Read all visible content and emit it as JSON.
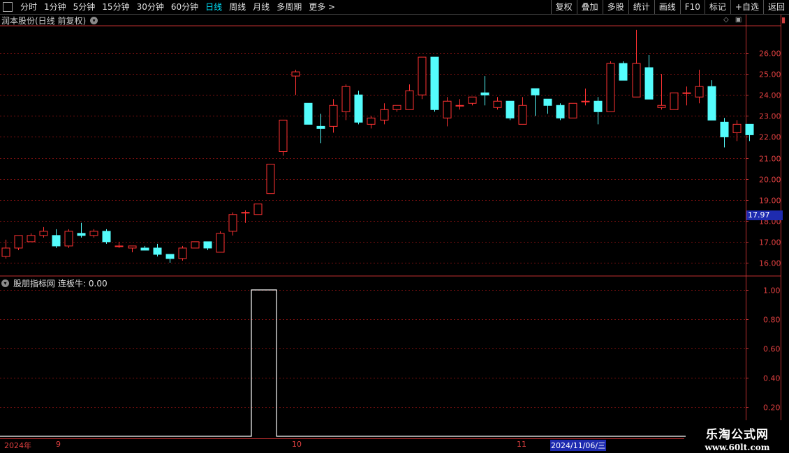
{
  "toolbar": {
    "left": [
      "分时",
      "1分钟",
      "5分钟",
      "15分钟",
      "30分钟",
      "60分钟",
      "日线",
      "周线",
      "月线",
      "多周期",
      "更多 >"
    ],
    "active": "日线",
    "right": [
      "复权",
      "叠加",
      "多股",
      "统计",
      "画线",
      "F10",
      "标记",
      "+自选",
      "返回"
    ]
  },
  "chart_title": "润本股份(日线 前复权)",
  "indicator_title": "股朋指标网",
  "indicator_value": "连板牛: 0.00",
  "current_price": "17.97",
  "watermark": {
    "line1": "乐淘公式网",
    "line2": "www.60lt.com"
  },
  "dates": {
    "year": "2024年",
    "m9": "9",
    "m10": "10",
    "m11": "11",
    "cursor": "2024/11/06/三"
  },
  "colors": {
    "up": "#ff3232",
    "down": "#54fcfc",
    "grid": "#7a1010",
    "axis": "#c03030",
    "line": "#ffffff"
  },
  "chart_data": {
    "type": "candlestick",
    "price_axis": {
      "min": 16.0,
      "max": 26.0,
      "ticks": [
        "16.00",
        "17.00",
        "18.00",
        "19.00",
        "20.00",
        "21.00",
        "22.00",
        "23.00",
        "24.00",
        "25.00",
        "26.00"
      ]
    },
    "candles": [
      [
        16.3,
        16.7,
        16.2,
        17.1
      ],
      [
        16.7,
        17.3,
        16.6,
        17.3
      ],
      [
        17.0,
        17.3,
        17.0,
        17.4
      ],
      [
        17.3,
        17.5,
        17.2,
        17.7
      ],
      [
        17.3,
        16.8,
        16.7,
        17.6
      ],
      [
        16.8,
        17.5,
        16.7,
        17.6
      ],
      [
        17.4,
        17.3,
        17.2,
        17.9
      ],
      [
        17.3,
        17.5,
        17.2,
        17.6
      ],
      [
        17.5,
        17.0,
        16.9,
        17.6
      ],
      [
        16.8,
        16.8,
        16.7,
        17.0
      ],
      [
        16.7,
        16.8,
        16.5,
        16.8
      ],
      [
        16.7,
        16.6,
        16.6,
        16.8
      ],
      [
        16.7,
        16.4,
        16.3,
        16.9
      ],
      [
        16.4,
        16.2,
        16.0,
        16.4
      ],
      [
        16.2,
        16.7,
        16.1,
        16.8
      ],
      [
        16.7,
        17.0,
        16.7,
        17.0
      ],
      [
        17.0,
        16.7,
        16.6,
        17.0
      ],
      [
        16.5,
        17.4,
        16.5,
        17.5
      ],
      [
        17.5,
        18.3,
        17.3,
        18.4
      ],
      [
        18.4,
        18.4,
        17.9,
        18.5
      ],
      [
        18.3,
        18.8,
        18.3,
        18.8
      ],
      [
        19.3,
        20.7,
        19.3,
        20.7
      ],
      [
        21.3,
        22.8,
        21.1,
        22.8
      ],
      [
        24.9,
        25.1,
        24.0,
        25.2
      ],
      [
        23.6,
        22.6,
        22.6,
        23.6
      ],
      [
        22.5,
        22.4,
        21.7,
        23.1
      ],
      [
        22.5,
        23.5,
        22.2,
        23.8
      ],
      [
        23.2,
        24.4,
        22.8,
        24.5
      ],
      [
        24.0,
        22.7,
        22.6,
        24.2
      ],
      [
        22.6,
        22.9,
        22.4,
        23.0
      ],
      [
        22.8,
        23.3,
        22.6,
        23.6
      ],
      [
        23.3,
        23.5,
        23.2,
        23.5
      ],
      [
        23.3,
        24.2,
        23.3,
        24.5
      ],
      [
        24.0,
        25.8,
        23.8,
        25.8
      ],
      [
        25.8,
        23.3,
        23.2,
        25.8
      ],
      [
        22.9,
        23.7,
        22.5,
        23.9
      ],
      [
        23.5,
        23.5,
        23.3,
        23.8
      ],
      [
        23.6,
        23.9,
        23.5,
        23.9
      ],
      [
        24.1,
        24.0,
        23.5,
        24.9
      ],
      [
        23.4,
        23.7,
        23.3,
        23.9
      ],
      [
        23.7,
        22.9,
        22.8,
        23.7
      ],
      [
        22.6,
        23.5,
        22.6,
        23.9
      ],
      [
        24.3,
        24.0,
        23.0,
        24.3
      ],
      [
        23.8,
        23.5,
        23.1,
        23.8
      ],
      [
        23.5,
        22.9,
        22.8,
        23.6
      ],
      [
        22.9,
        23.6,
        22.9,
        23.6
      ],
      [
        23.7,
        23.7,
        23.5,
        24.3
      ],
      [
        23.7,
        23.2,
        22.6,
        23.9
      ],
      [
        23.2,
        25.5,
        23.2,
        25.6
      ],
      [
        25.5,
        24.7,
        24.7,
        25.6
      ],
      [
        23.9,
        25.5,
        23.9,
        27.1
      ],
      [
        25.3,
        23.8,
        23.8,
        25.9
      ],
      [
        23.4,
        23.5,
        23.3,
        25.0
      ],
      [
        23.3,
        24.1,
        23.3,
        24.1
      ],
      [
        24.1,
        24.1,
        23.5,
        24.4
      ],
      [
        23.9,
        24.4,
        23.6,
        25.2
      ],
      [
        24.4,
        22.8,
        22.8,
        24.7
      ],
      [
        22.7,
        22.0,
        21.5,
        22.9
      ],
      [
        22.2,
        22.6,
        21.8,
        22.8
      ],
      [
        22.6,
        22.1,
        21.8,
        22.6
      ]
    ],
    "indicator": {
      "name": "连板牛",
      "y_ticks": [
        "0.20",
        "0.40",
        "0.60",
        "0.80",
        "1.00"
      ],
      "values": [
        0,
        0,
        0,
        0,
        0,
        0,
        0,
        0,
        0,
        0,
        0,
        0,
        0,
        0,
        0,
        0,
        0,
        0,
        0,
        0,
        1,
        1,
        0,
        0,
        0,
        0,
        0,
        0,
        0,
        0,
        0,
        0,
        0,
        0,
        0,
        0,
        0,
        0,
        0,
        0,
        0,
        0,
        0,
        0,
        0,
        0,
        0,
        0,
        0,
        0,
        0,
        0,
        0,
        0,
        0,
        0,
        0,
        0,
        0,
        0
      ]
    }
  }
}
